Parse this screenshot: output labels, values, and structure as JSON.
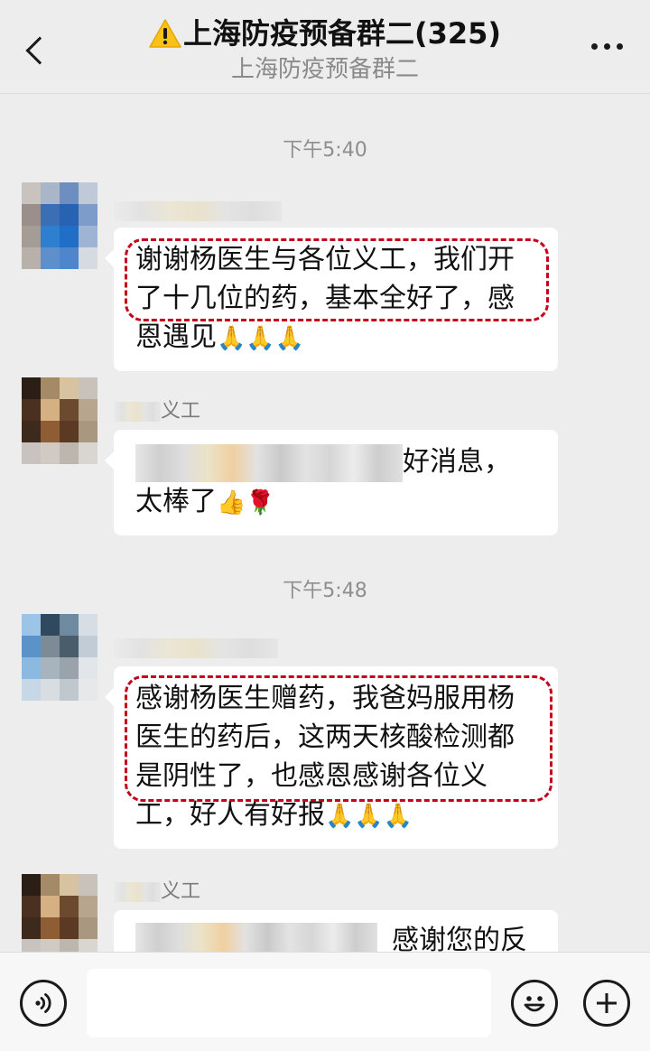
{
  "header": {
    "title": "上海防疫预备群二(325)",
    "subtitle": "上海防疫预备群二",
    "back_icon": "chevron-left-icon",
    "more_icon": "more-dots-icon",
    "warning_icon": "warning-icon"
  },
  "messages": {
    "time1": "下午5:40",
    "msg1": {
      "text_highlighted": "谢谢杨医生与各位义工，我们开了十几位的药，基本全好了，",
      "text_rest": "感恩遇见",
      "emoji": "🙏🙏🙏"
    },
    "nick2_suffix": "义工",
    "msg2": {
      "text_after_censor": "好消息，",
      "text_line2": "太棒了",
      "emoji": "👍🌹"
    },
    "time2": "下午5:48",
    "msg3": {
      "text_highlighted": "感谢杨医生赠药，我爸妈服用杨医生的药后，这两天核酸检测都是阴性了，也感恩感谢各",
      "text_rest": "位义工，好人有好报",
      "emoji": "🙏🙏🙏"
    },
    "nick4_suffix": "义工",
    "msg4": {
      "text_after_censor": "感谢您的反"
    }
  },
  "inputbar": {
    "voice_icon": "voice-icon",
    "emoji_icon": "smiley-icon",
    "plus_icon": "plus-icon"
  },
  "colors": {
    "background": "#ededed",
    "highlight_dash": "#c4001a",
    "bubble": "#ffffff"
  }
}
